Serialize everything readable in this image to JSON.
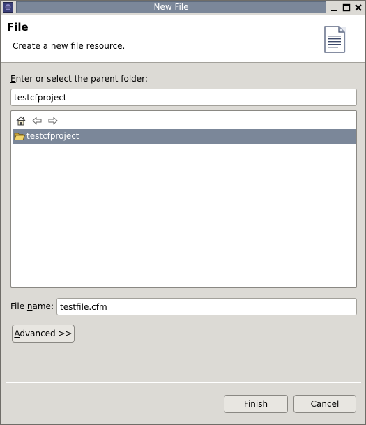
{
  "window": {
    "title": "New File"
  },
  "header": {
    "title": "File",
    "description": "Create a new file resource."
  },
  "parent_folder": {
    "label_mnemonic": "E",
    "label_rest": "nter or select the parent folder:",
    "value": "testcfproject"
  },
  "tree": {
    "items": [
      {
        "label": "testcfproject",
        "selected": true
      }
    ]
  },
  "file_name": {
    "label_pre": "File ",
    "label_mnemonic": "n",
    "label_post": "ame:",
    "value": "testfile.cfm"
  },
  "buttons": {
    "advanced_mnemonic": "A",
    "advanced_rest": "dvanced >>",
    "finish_mnemonic": "F",
    "finish_rest": "inish",
    "cancel": "Cancel"
  },
  "colors": {
    "selection": "#7b8799",
    "dialog_bg": "#dcdad5"
  }
}
